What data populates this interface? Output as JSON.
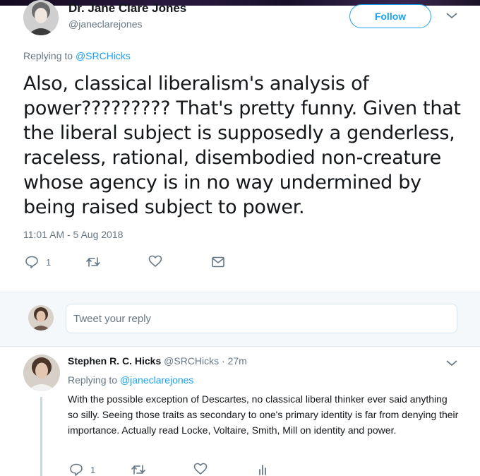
{
  "main_tweet": {
    "author_name": "Dr. Jane Clare Jones",
    "author_handle": "@janeclarejones",
    "follow_label": "Follow",
    "replying_to_prefix": "Replying to ",
    "replying_to_handle": "@SRCHicks",
    "text": "Also, classical liberalism's analysis of power????????? That's pretty funny. Given that the liberal subject is supposedly a genderless, raceless, rational, disembodied non-creature whose agency is in no way undermined by being raised subject to power.",
    "timestamp": "11:01 AM - 5 Aug 2018",
    "reply_count": "1"
  },
  "reply_box": {
    "placeholder": "Tweet your reply"
  },
  "reply_tweet": {
    "author_name": "Stephen R. C. Hicks",
    "author_handle": "@SRCHicks",
    "separator": " · ",
    "time_ago": "27m",
    "replying_to_prefix": "Replying to ",
    "replying_to_handle": "@janeclarejones",
    "text": "With the possible exception of Descartes, no classical liberal thinker ever said anything so silly. Seeing those traits as secondary to one's primary identity is far from denying their importance. Actually read Locke, Voltaire, Smith, Mill on identity and power.",
    "reply_count": "1"
  },
  "colors": {
    "accent": "#1da1f2",
    "secondary_text": "#657786",
    "primary_text": "#14171a"
  },
  "icons": [
    "reply-icon",
    "retweet-icon",
    "like-icon",
    "direct-message-icon",
    "analytics-icon",
    "chevron-down-icon"
  ]
}
